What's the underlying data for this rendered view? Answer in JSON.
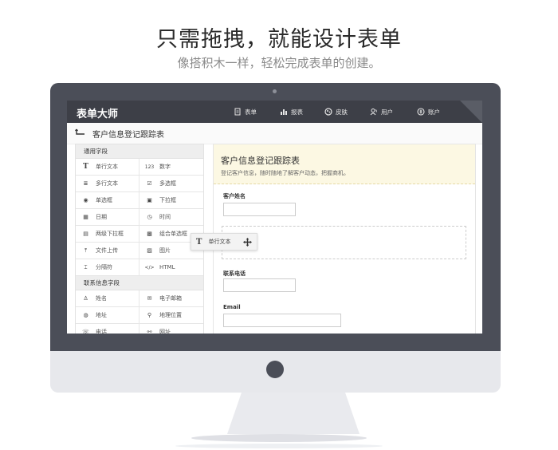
{
  "hero": {
    "title": "只需拖拽，就能设计表单",
    "subtitle": "像搭积木一样，轻松完成表单的创建。"
  },
  "app": {
    "brand": "表单大师",
    "nav": [
      {
        "label": "表单",
        "icon": "document-icon"
      },
      {
        "label": "报表",
        "icon": "bar-chart-icon"
      },
      {
        "label": "皮肤",
        "icon": "palette-icon"
      },
      {
        "label": "用户",
        "icon": "users-icon"
      },
      {
        "label": "账户",
        "icon": "account-icon"
      }
    ],
    "breadcrumb": "客户信息登记跟踪表"
  },
  "fields_panel": {
    "common_header": "通用字段",
    "common": [
      {
        "label": "单行文本",
        "icon": "text-icon"
      },
      {
        "label": "数字",
        "icon": "number-icon"
      },
      {
        "label": "多行文本",
        "icon": "paragraph-icon"
      },
      {
        "label": "多选框",
        "icon": "checkbox-icon"
      },
      {
        "label": "单选框",
        "icon": "radio-icon"
      },
      {
        "label": "下拉框",
        "icon": "dropdown-icon"
      },
      {
        "label": "日期",
        "icon": "calendar-icon"
      },
      {
        "label": "时间",
        "icon": "clock-icon"
      },
      {
        "label": "两级下拉框",
        "icon": "cascade-icon"
      },
      {
        "label": "组合单选框",
        "icon": "combo-radio-icon"
      },
      {
        "label": "文件上传",
        "icon": "upload-icon"
      },
      {
        "label": "图片",
        "icon": "image-icon"
      },
      {
        "label": "分隔符",
        "icon": "divider-icon"
      },
      {
        "label": "HTML",
        "icon": "code-icon"
      }
    ],
    "contact_header": "联系信息字段",
    "contact": [
      {
        "label": "姓名",
        "icon": "person-icon"
      },
      {
        "label": "电子邮箱",
        "icon": "mail-icon"
      },
      {
        "label": "地址",
        "icon": "globe-icon"
      },
      {
        "label": "地理位置",
        "icon": "location-icon"
      },
      {
        "label": "电话",
        "icon": "phone-icon"
      },
      {
        "label": "网址",
        "icon": "link-icon"
      }
    ]
  },
  "drag_chip": {
    "label": "单行文本",
    "glyph": "T"
  },
  "form": {
    "title": "客户信息登记跟踪表",
    "description": "登记客户信息，随时随地了解客户动态，把握商机。",
    "fields": [
      {
        "label": "客户姓名"
      },
      {
        "label": "联系电话"
      },
      {
        "label": "Email"
      }
    ]
  }
}
